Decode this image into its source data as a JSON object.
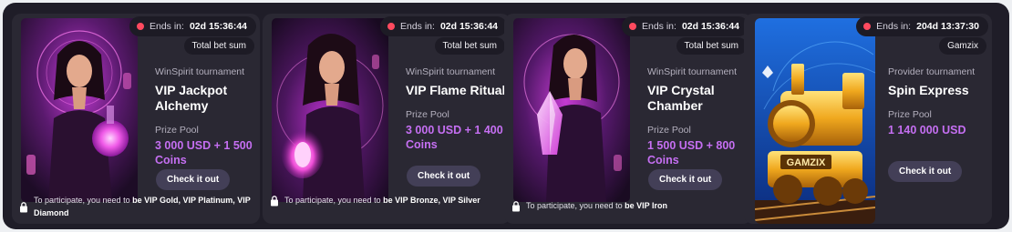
{
  "cards": [
    {
      "ends_label": "Ends in:",
      "ends_value": "02d 15:36:44",
      "tag": "Total bet sum",
      "type": "WinSpirit tournament",
      "title": "VIP Jackpot Alchemy",
      "pool_label": "Prize Pool",
      "pool": "3 000 USD + 1 500 Coins",
      "button": "Check it out",
      "cond_prefix": "To participate, you need to",
      "cond_value": "be VIP Gold, VIP Platinum, VIP Diamond",
      "image_icon": "sorceress-potion-art"
    },
    {
      "ends_label": "Ends in:",
      "ends_value": "02d 15:36:44",
      "tag": "Total bet sum",
      "type": "WinSpirit tournament",
      "title": "VIP Flame Ritual",
      "pool_label": "Prize Pool",
      "pool": "3 000 USD + 1 400 Coins",
      "button": "Check it out",
      "cond_prefix": "To participate, you need to",
      "cond_value": "be VIP Bronze, VIP Silver",
      "image_icon": "sorceress-flame-art"
    },
    {
      "ends_label": "Ends in:",
      "ends_value": "02d 15:36:44",
      "tag": "Total bet sum",
      "type": "WinSpirit tournament",
      "title": "VIP Crystal Chamber",
      "pool_label": "Prize Pool",
      "pool": "1 500 USD + 800 Coins",
      "button": "Check it out",
      "cond_prefix": "To participate, you need to",
      "cond_value": "be VIP Iron",
      "image_icon": "sorceress-crystal-art"
    },
    {
      "ends_label": "Ends in:",
      "ends_value": "204d 13:37:30",
      "tag": "Gamzix",
      "type": "Provider tournament",
      "title": "Spin Express",
      "pool_label": "Prize Pool",
      "pool": "1 140 000 USD",
      "button": "Check it out",
      "image_icon": "golden-train-art",
      "image_text": "GAMZIX"
    }
  ],
  "colors": {
    "accent_purple": "#c56ff2",
    "timer_dot": "#ff4a5f",
    "card_bg": "#2a2833",
    "button_bg": "#433f57"
  }
}
